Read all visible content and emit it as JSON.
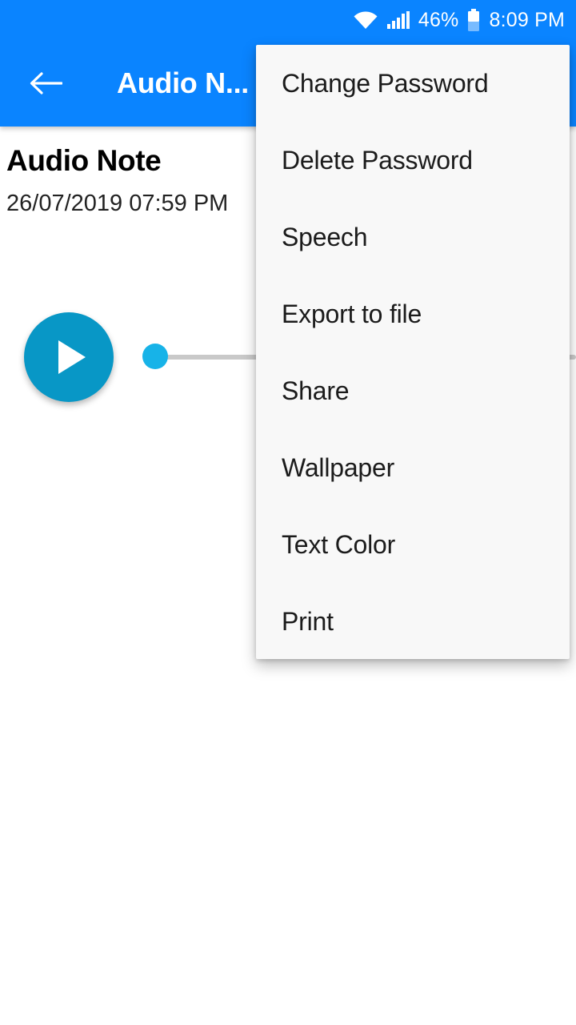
{
  "status_bar": {
    "wifi_icon": "wifi-icon",
    "signal_icon": "signal-bars-icon",
    "battery_percent": "46%",
    "battery_icon": "battery-icon",
    "time": "8:09 PM"
  },
  "app_bar": {
    "back_icon": "back-arrow-icon",
    "title": "Audio N...",
    "overflow_icon": "overflow-menu-icon"
  },
  "note": {
    "title": "Audio Note",
    "timestamp": "26/07/2019 07:59 PM"
  },
  "player": {
    "play_icon": "play-icon",
    "seek_position_percent": 0
  },
  "overflow_menu": {
    "items": [
      {
        "label": "Change Password"
      },
      {
        "label": "Delete Password"
      },
      {
        "label": "Speech"
      },
      {
        "label": "Export to file"
      },
      {
        "label": "Share"
      },
      {
        "label": "Wallpaper"
      },
      {
        "label": "Text Color"
      },
      {
        "label": "Print"
      }
    ]
  },
  "colors": {
    "app_bar_blue": "#0A84FF",
    "play_button_teal": "#0897C6",
    "seek_thumb_cyan": "#17B3E8",
    "menu_background": "#F8F8F8",
    "page_background": "#FFFFFF"
  }
}
